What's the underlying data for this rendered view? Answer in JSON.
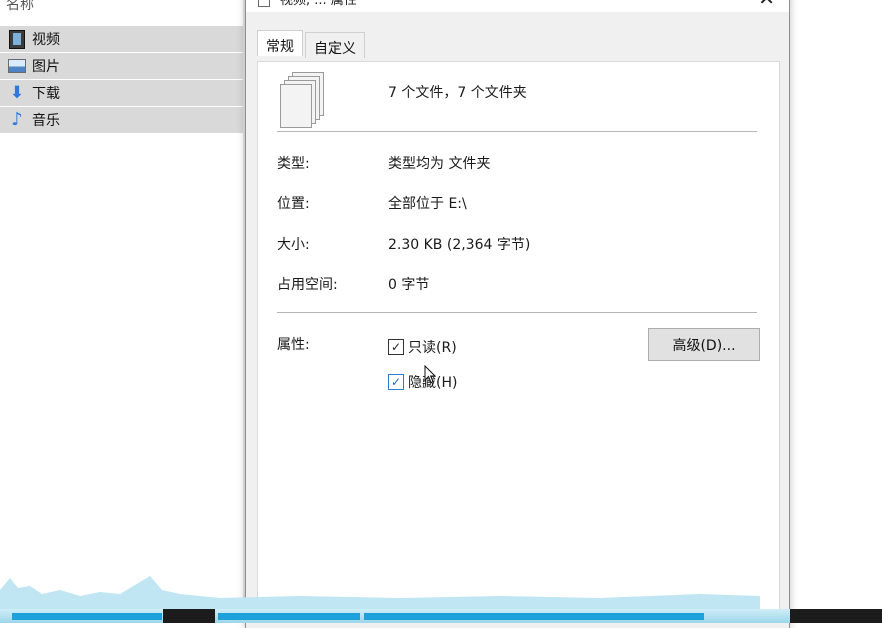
{
  "explorer": {
    "column_header": "名称",
    "folders": [
      {
        "label": "视频",
        "icon": "video-folder-icon"
      },
      {
        "label": "图片",
        "icon": "pictures-folder-icon"
      },
      {
        "label": "下载",
        "icon": "downloads-folder-icon"
      },
      {
        "label": "音乐",
        "icon": "music-folder-icon"
      }
    ]
  },
  "dialog": {
    "title": "视频, ... 属性",
    "close_glyph": "✕",
    "tabs": [
      {
        "label": "常规",
        "active": true
      },
      {
        "label": "自定义",
        "active": false
      }
    ],
    "summary": "7 个文件，7 个文件夹",
    "properties": {
      "type_label": "类型:",
      "type_value": "类型均为 文件夹",
      "location_label": "位置:",
      "location_value": "全部位于 E:\\",
      "size_label": "大小:",
      "size_value": "2.30 KB (2,364 字节)",
      "disk_label": "占用空间:",
      "disk_value": "0 字节"
    },
    "attributes": {
      "label": "属性:",
      "readonly": {
        "label": "只读(R)",
        "checked": true
      },
      "hidden": {
        "label": "隐藏(H)",
        "checked": true
      },
      "advanced_button": "高级(D)..."
    }
  },
  "colors": {
    "selected_row": "#d9d9d9",
    "dialog_bg": "#f0f0f0",
    "accent_blue": "#1da1db"
  }
}
